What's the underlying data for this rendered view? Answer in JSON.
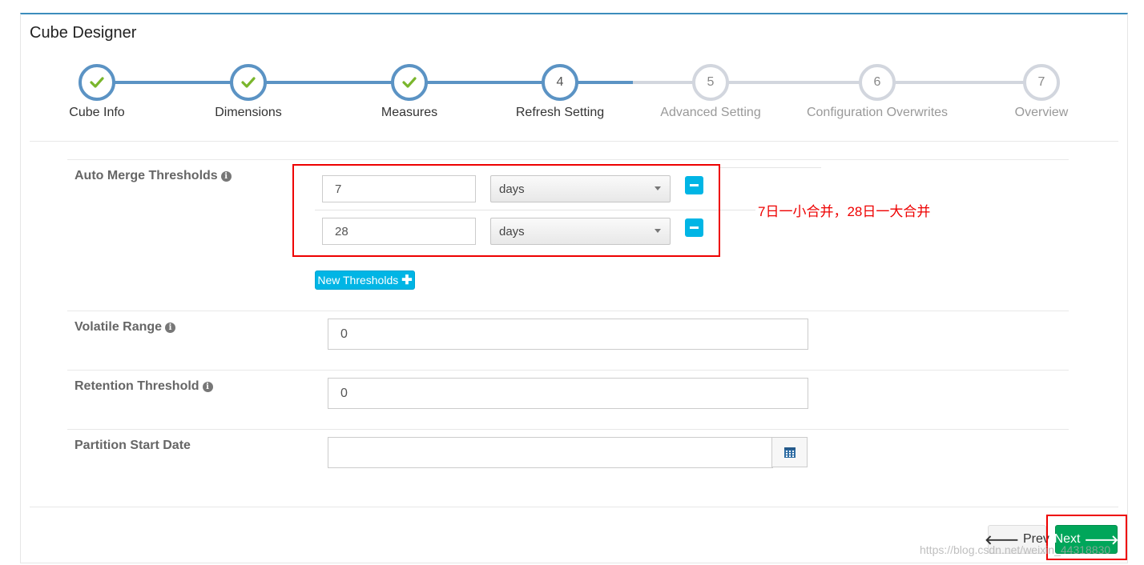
{
  "panel": {
    "title": "Cube Designer"
  },
  "wizard": {
    "steps": [
      {
        "number": "1",
        "label": "Cube Info",
        "state": "done"
      },
      {
        "number": "2",
        "label": "Dimensions",
        "state": "done"
      },
      {
        "number": "3",
        "label": "Measures",
        "state": "done"
      },
      {
        "number": "4",
        "label": "Refresh Setting",
        "state": "current"
      },
      {
        "number": "5",
        "label": "Advanced Setting",
        "state": "todo"
      },
      {
        "number": "6",
        "label": "Configuration Overwrites",
        "state": "todo"
      },
      {
        "number": "7",
        "label": "Overview",
        "state": "todo"
      }
    ]
  },
  "form": {
    "auto_merge": {
      "label": "Auto Merge Thresholds",
      "thresholds": [
        {
          "value": "7",
          "unit": "days"
        },
        {
          "value": "28",
          "unit": "days"
        }
      ],
      "new_button": "New Thresholds"
    },
    "volatile_range": {
      "label": "Volatile Range",
      "value": "0"
    },
    "retention_threshold": {
      "label": "Retention Threshold",
      "value": "0"
    },
    "partition_start_date": {
      "label": "Partition Start Date",
      "value": ""
    }
  },
  "annotation": {
    "text": "7日一小合并，28日一大合并"
  },
  "footer": {
    "prev": "Prev",
    "next": "Next"
  },
  "watermark": "https://blog.csdn.net/weixin_44318830",
  "colors": {
    "accent": "#3c8dbc",
    "step_done": "#5b93c4",
    "check": "#7ab62c",
    "info_button": "#00b5e5",
    "next_button": "#00a65a",
    "highlight": "#e00000"
  }
}
